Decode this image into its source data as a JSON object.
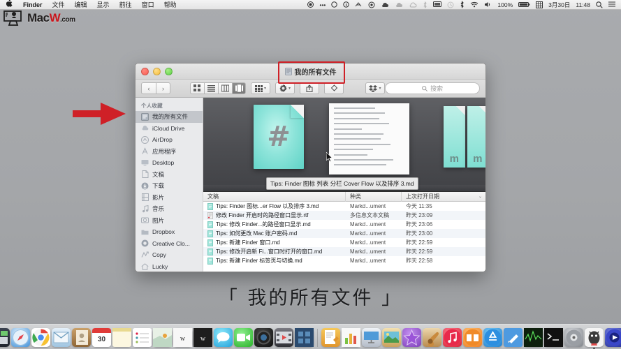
{
  "menubar": {
    "apple_icon": "apple-icon",
    "app_name": "Finder",
    "items": [
      "文件",
      "编辑",
      "显示",
      "前往",
      "窗口",
      "帮助"
    ],
    "status": {
      "battery_percent": "100%",
      "date": "3月30日",
      "time": "11:48",
      "icons": [
        "record-icon",
        "ellipsis-icon",
        "circle-icon",
        "info-icon",
        "antenna-icon",
        "at-icon",
        "cloud-icon",
        "cloud-dim-icon",
        "cloud-up-icon",
        "bluetooth-small-icon",
        "display-icon",
        "time-machine-icon",
        "bluetooth-icon",
        "wifi-icon",
        "volume-icon",
        "battery-icon",
        "calendar-grid-icon",
        "search-icon",
        "list-icon"
      ]
    }
  },
  "watermark": {
    "text_mac": "Mac",
    "text_w": "W",
    "text_com": ".com"
  },
  "finder": {
    "title": "我的所有文件",
    "nav": {
      "back": "‹",
      "forward": "›"
    },
    "views": [
      "icon-view",
      "list-view",
      "column-view",
      "coverflow-view"
    ],
    "view_active_index": 3,
    "toolbar_buttons": [
      "arrange-icon",
      "action-gear-icon",
      "share-icon",
      "tags-icon",
      "dropbox-icon"
    ],
    "search": {
      "placeholder": "搜索",
      "icon": "search-icon"
    },
    "sidebar": {
      "header": "个人收藏",
      "items": [
        {
          "label": "我的所有文件",
          "icon": "all-files-icon",
          "selected": true
        },
        {
          "label": "iCloud Drive",
          "icon": "icloud-icon",
          "selected": false
        },
        {
          "label": "AirDrop",
          "icon": "airdrop-icon",
          "selected": false
        },
        {
          "label": "应用程序",
          "icon": "applications-icon",
          "selected": false
        },
        {
          "label": "Desktop",
          "icon": "desktop-icon",
          "selected": false
        },
        {
          "label": "文稿",
          "icon": "documents-icon",
          "selected": false
        },
        {
          "label": "下载",
          "icon": "downloads-icon",
          "selected": false
        },
        {
          "label": "影片",
          "icon": "movies-icon",
          "selected": false
        },
        {
          "label": "音乐",
          "icon": "music-icon",
          "selected": false
        },
        {
          "label": "图片",
          "icon": "pictures-icon",
          "selected": false
        },
        {
          "label": "Dropbox",
          "icon": "folder-icon",
          "selected": false
        },
        {
          "label": "Creative Clo...",
          "icon": "creative-cloud-icon",
          "selected": false
        },
        {
          "label": "Copy",
          "icon": "copy-icon",
          "selected": false
        },
        {
          "label": "Lucky",
          "icon": "home-icon",
          "selected": false
        }
      ]
    },
    "coverflow": {
      "tooltip": "Tips: Finder 图标 列表 分栏 Cover Flow 以及排序 3.md",
      "doc_glyph": "#",
      "side_glyph": "m"
    },
    "list": {
      "columns": [
        "文稿",
        "种类",
        "上次打开日期"
      ],
      "sort_caret": "⌄",
      "rows": [
        {
          "name": "Tips: Finder 图标...er Flow 以及排序 3.md",
          "kind": "Markd...ument",
          "date": "今天 11:35",
          "icon": "markdown-file-icon"
        },
        {
          "name": "修改 Finder 开启时的路径窗口显示.rtf",
          "kind": "多信息文本文稿",
          "date": "昨天 23:09",
          "icon": "rtf-file-icon"
        },
        {
          "name": "Tips: 修改 Finder...的路径窗口显示.md",
          "kind": "Markd...ument",
          "date": "昨天 23:06",
          "icon": "markdown-file-icon"
        },
        {
          "name": "Tips: 如何更改 Mac 账户密码.md",
          "kind": "Markd...ument",
          "date": "昨天 23:00",
          "icon": "markdown-file-icon"
        },
        {
          "name": "Tips: 新建 Finder 窗口.md",
          "kind": "Markd...ument",
          "date": "昨天 22:59",
          "icon": "markdown-file-icon"
        },
        {
          "name": "Tips: 修改开启新 Fi...窗口时打开的窗口.md",
          "kind": "Markd...ument",
          "date": "昨天 22:59",
          "icon": "markdown-file-icon"
        },
        {
          "name": "Tips: 新建 Finder 标签页与切换.md",
          "kind": "Markd...ument",
          "date": "昨天 22:58",
          "icon": "markdown-file-icon"
        }
      ]
    }
  },
  "caption": "「 我的所有文件 」",
  "dock": {
    "calendar_day": "30",
    "items": [
      {
        "name": "finder",
        "color1": "#8fd2f5",
        "color2": "#3a7fbf"
      },
      {
        "name": "launchpad",
        "color1": "#d8d9dc",
        "color2": "#9a9da2"
      },
      {
        "name": "mission-control",
        "color1": "#3b4250",
        "color2": "#20252e"
      },
      {
        "name": "safari",
        "color1": "#cfe8fb",
        "color2": "#3f90d8"
      },
      {
        "name": "chrome",
        "color1": "#f8f8f8",
        "color2": "#d8d8d8"
      },
      {
        "name": "mail",
        "color1": "#cfe3f2",
        "color2": "#7fb4d8"
      },
      {
        "name": "contacts",
        "color1": "#caa069",
        "color2": "#9a6f3c"
      },
      {
        "name": "calendar",
        "color1": "#ffffff",
        "color2": "#e8e8e8"
      },
      {
        "name": "notes",
        "color1": "#fdf6d8",
        "color2": "#efe2a4"
      },
      {
        "name": "reminders",
        "color1": "#fdfdfd",
        "color2": "#e4e4e4"
      },
      {
        "name": "maps",
        "color1": "#ddeedd",
        "color2": "#a9ccb4"
      },
      {
        "name": "word-a",
        "color1": "#f7f7f7",
        "color2": "#dcdcdc"
      },
      {
        "name": "word-b",
        "color1": "#2a2a2a",
        "color2": "#111111"
      },
      {
        "name": "messages",
        "color1": "#7fe3f5",
        "color2": "#2aa9e0"
      },
      {
        "name": "facetime",
        "color1": "#7ce57c",
        "color2": "#2db42d"
      },
      {
        "name": "photos",
        "color1": "#3a3a3a",
        "color2": "#101010"
      },
      {
        "name": "imovie",
        "color1": "#6d6d75",
        "color2": "#2f3036"
      },
      {
        "name": "final-cut",
        "color1": "#3d5d80",
        "color2": "#1f3550"
      },
      {
        "name": "pages",
        "color1": "#f6c85a",
        "color2": "#e0952e"
      },
      {
        "name": "numbers",
        "color1": "#f4f4f4",
        "color2": "#dadada"
      },
      {
        "name": "keynote",
        "color1": "#e8ecf2",
        "color2": "#b4bcc8"
      },
      {
        "name": "iphoto",
        "color1": "#f0d9a0",
        "color2": "#c9a15c"
      },
      {
        "name": "imovie-star",
        "color1": "#b97fe0",
        "color2": "#7d3fba"
      },
      {
        "name": "garageband",
        "color1": "#e8d0a8",
        "color2": "#b98b4e"
      },
      {
        "name": "itunes",
        "color1": "#ff6b7a",
        "color2": "#e02033"
      },
      {
        "name": "ibooks",
        "color1": "#ffb05a",
        "color2": "#ef7f20"
      },
      {
        "name": "app-store",
        "color1": "#5fc0f5",
        "color2": "#1e7fd0"
      },
      {
        "name": "xcode",
        "color1": "#6fb8f0",
        "color2": "#2a6fc0"
      },
      {
        "name": "activity-monitor",
        "color1": "#1f2b1f",
        "color2": "#050a05"
      },
      {
        "name": "terminal",
        "color1": "#2a2a2a",
        "color2": "#0a0a0a"
      },
      {
        "name": "system-preferences",
        "color1": "#c8cace",
        "color2": "#7d8086"
      },
      {
        "name": "qq",
        "color1": "#f2f2f2",
        "color2": "#d2d2d2"
      },
      {
        "name": "quicktime",
        "color1": "#5c6bd8",
        "color2": "#1f2a9a"
      },
      {
        "name": "downloads-stack",
        "color1": "#dfe7ef",
        "color2": "#9fb0c2"
      },
      {
        "name": "trash",
        "color1": "#e8eaec",
        "color2": "#b8bcc0"
      }
    ]
  }
}
